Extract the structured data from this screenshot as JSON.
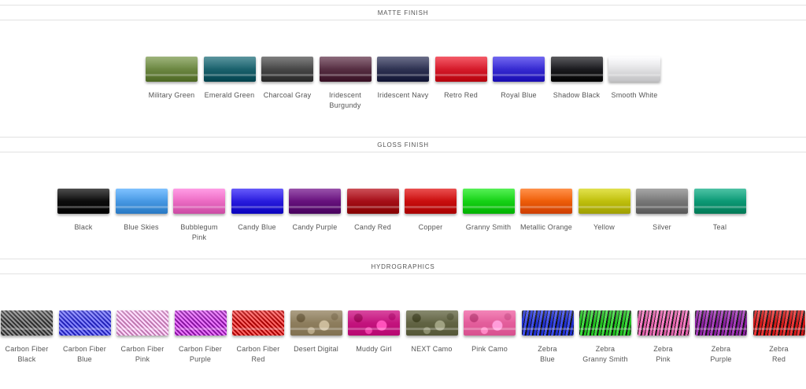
{
  "sections": {
    "matte": {
      "title": "MATTE FINISH",
      "items": [
        {
          "label": "Military Green",
          "color": "#6f8a45"
        },
        {
          "label": "Emerald Green",
          "color": "#1e6570"
        },
        {
          "label": "Charcoal Gray",
          "color": "#4a4a4a"
        },
        {
          "label": "Iridescent\nBurgundy",
          "color": "#5a3246"
        },
        {
          "label": "Iridescent Navy",
          "color": "#323656"
        },
        {
          "label": "Retro Red",
          "color": "#d81e2e"
        },
        {
          "label": "Royal Blue",
          "color": "#3a2ed4"
        },
        {
          "label": "Shadow Black",
          "color": "#1e1e22"
        },
        {
          "label": "Smooth White",
          "color": "#e4e4e6"
        }
      ]
    },
    "gloss": {
      "title": "GLOSS FINISH",
      "items": [
        {
          "label": "Black",
          "color": "#0e0e0e"
        },
        {
          "label": "Blue Skies",
          "color": "#4a9be6"
        },
        {
          "label": "Bubblegum Pink",
          "color": "#ee6ec6"
        },
        {
          "label": "Candy Blue",
          "color": "#2c1ee0"
        },
        {
          "label": "Candy Purple",
          "color": "#6a1480"
        },
        {
          "label": "Candy Red",
          "color": "#a8101a"
        },
        {
          "label": "Copper",
          "color": "#cc1010"
        },
        {
          "label": "Granny Smith",
          "color": "#18d418"
        },
        {
          "label": "Metallic Orange",
          "color": "#f0600a"
        },
        {
          "label": "Yellow",
          "color": "#c2c20e"
        },
        {
          "label": "Silver",
          "color": "#7a7a7a"
        },
        {
          "label": "Teal",
          "color": "#0e9c78"
        }
      ]
    },
    "hydro": {
      "title": "HYDROGRAPHICS",
      "items": [
        {
          "label": "Carbon Fiber\nBlack",
          "color": "#555555",
          "pattern": "carbon"
        },
        {
          "label": "Carbon Fiber\nBlue",
          "color": "#4a4ae0",
          "pattern": "carbon"
        },
        {
          "label": "Carbon Fiber\nPink",
          "color": "#e8a0d8",
          "pattern": "carbon"
        },
        {
          "label": "Carbon Fiber\nPurple",
          "color": "#b03cc8",
          "pattern": "carbon"
        },
        {
          "label": "Carbon Fiber\nRed",
          "color": "#d02a2a",
          "pattern": "carbon"
        },
        {
          "label": "Desert Digital",
          "color": "#9a8a6a",
          "pattern": "camo"
        },
        {
          "label": "Muddy Girl",
          "color": "#d0208a",
          "pattern": "camo"
        },
        {
          "label": "NEXT Camo",
          "color": "#6e7050",
          "pattern": "camo"
        },
        {
          "label": "Pink Camo",
          "color": "#f06aa8",
          "pattern": "camo"
        },
        {
          "label": "Zebra\nBlue",
          "color": "#2030d0",
          "pattern": "zebra"
        },
        {
          "label": "Zebra\nGranny Smith",
          "color": "#20c020",
          "pattern": "zebra"
        },
        {
          "label": "Zebra\nPink",
          "color": "#e060a8",
          "pattern": "zebra"
        },
        {
          "label": "Zebra\nPurple",
          "color": "#8a20a0",
          "pattern": "zebra"
        },
        {
          "label": "Zebra\nRed",
          "color": "#d01818",
          "pattern": "zebra"
        }
      ]
    }
  }
}
